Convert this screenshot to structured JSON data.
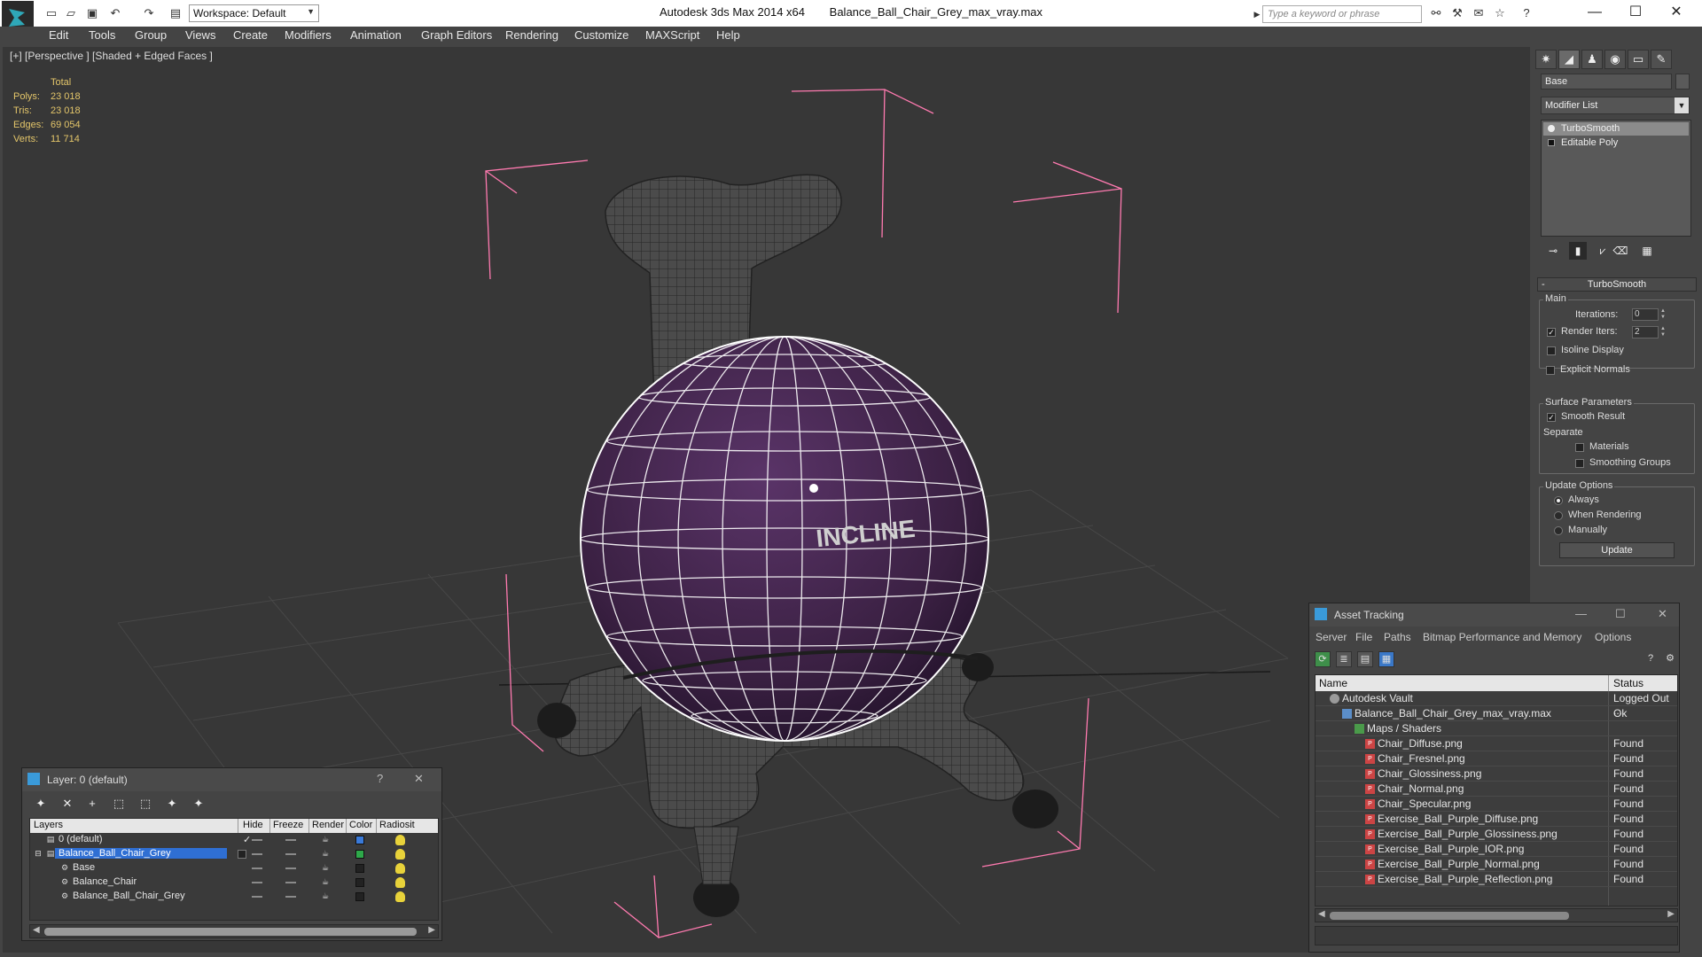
{
  "title_bar": {
    "app_title": "Autodesk 3ds Max  2014 x64",
    "file_name": "Balance_Ball_Chair_Grey_max_vray.max",
    "workspace_label": "Workspace: Default",
    "search_placeholder": "Type a keyword or phrase",
    "icons": [
      "new-icon",
      "open-icon",
      "save-icon",
      "undo-icon",
      "redo-icon",
      "project-icon"
    ],
    "window_controls": [
      "minimize",
      "maximize",
      "close"
    ]
  },
  "menu": {
    "items": [
      "Edit",
      "Tools",
      "Group",
      "Views",
      "Create",
      "Modifiers",
      "Animation",
      "Graph Editors",
      "Rendering",
      "Customize",
      "MAXScript",
      "Help"
    ]
  },
  "viewport": {
    "label": "[+] [Perspective ] [Shaded + Edged Faces ]",
    "stats": {
      "header": "Total",
      "rows": [
        {
          "label": "Polys:",
          "value": "23 018"
        },
        {
          "label": "Tris:",
          "value": "23 018"
        },
        {
          "label": "Edges:",
          "value": "69 054"
        },
        {
          "label": "Verts:",
          "value": "11 714"
        }
      ]
    },
    "ball_text": "INCLINE",
    "colors": {
      "background": "#373737",
      "ball": "#3e2446",
      "wire": "#ffffff",
      "bbox": "#ff7ab0",
      "chair": "#4a4a4a"
    }
  },
  "command_panel": {
    "object_name": "Base",
    "modifier_list": "Modifier List",
    "stack": [
      {
        "label": "TurboSmooth",
        "selected": true
      },
      {
        "label": "Editable Poly",
        "selected": false
      }
    ],
    "turbosmooth": {
      "title": "TurboSmooth",
      "main": "Main",
      "iterations_label": "Iterations:",
      "iterations_value": "0",
      "render_iters_label": "Render Iters:",
      "render_iters_value": "2",
      "isoline": "Isoline Display",
      "explicit": "Explicit Normals",
      "surface_title": "Surface Parameters",
      "smooth_result": "Smooth Result",
      "separate": "Separate",
      "materials": "Materials",
      "smoothing_groups": "Smoothing Groups",
      "update_title": "Update Options",
      "always": "Always",
      "when_rendering": "When Rendering",
      "manually": "Manually",
      "update_button": "Update"
    }
  },
  "asset_tracking": {
    "title": "Asset Tracking",
    "menu": [
      "Server",
      "File",
      "Paths",
      "Bitmap Performance and Memory",
      "Options"
    ],
    "columns": [
      "Name",
      "Status"
    ],
    "rows": [
      {
        "name": "Autodesk Vault",
        "status": "Logged Out ...",
        "type": "vault"
      },
      {
        "name": "Balance_Ball_Chair_Grey_max_vray.max",
        "status": "Ok",
        "type": "max"
      },
      {
        "name": "Maps / Shaders",
        "status": "",
        "type": "map"
      },
      {
        "name": "Chair_Diffuse.png",
        "status": "Found",
        "type": "png"
      },
      {
        "name": "Chair_Fresnel.png",
        "status": "Found",
        "type": "png"
      },
      {
        "name": "Chair_Glossiness.png",
        "status": "Found",
        "type": "png"
      },
      {
        "name": "Chair_Normal.png",
        "status": "Found",
        "type": "png"
      },
      {
        "name": "Chair_Specular.png",
        "status": "Found",
        "type": "png"
      },
      {
        "name": "Exercise_Ball_Purple_Diffuse.png",
        "status": "Found",
        "type": "png"
      },
      {
        "name": "Exercise_Ball_Purple_Glossiness.png",
        "status": "Found",
        "type": "png"
      },
      {
        "name": "Exercise_Ball_Purple_IOR.png",
        "status": "Found",
        "type": "png"
      },
      {
        "name": "Exercise_Ball_Purple_Normal.png",
        "status": "Found",
        "type": "png"
      },
      {
        "name": "Exercise_Ball_Purple_Reflection.png",
        "status": "Found",
        "type": "png"
      }
    ]
  },
  "layers": {
    "title": "Layer: 0 (default)",
    "help": "?",
    "columns": [
      "Layers",
      "Hide",
      "Freeze",
      "Render",
      "Color",
      "Radiosit"
    ],
    "rows": [
      {
        "name": "0 (default)",
        "color": "#3a7ad9",
        "selected": false,
        "check": "✓"
      },
      {
        "name": "Balance_Ball_Chair_Grey",
        "color": "#2ea84a",
        "selected": true,
        "check": ""
      },
      {
        "name": "Base",
        "color": "#222222",
        "selected": false,
        "check": ""
      },
      {
        "name": "Balance_Chair",
        "color": "#222222",
        "selected": false,
        "check": ""
      },
      {
        "name": "Balance_Ball_Chair_Grey",
        "color": "#222222",
        "selected": false,
        "check": ""
      }
    ]
  }
}
